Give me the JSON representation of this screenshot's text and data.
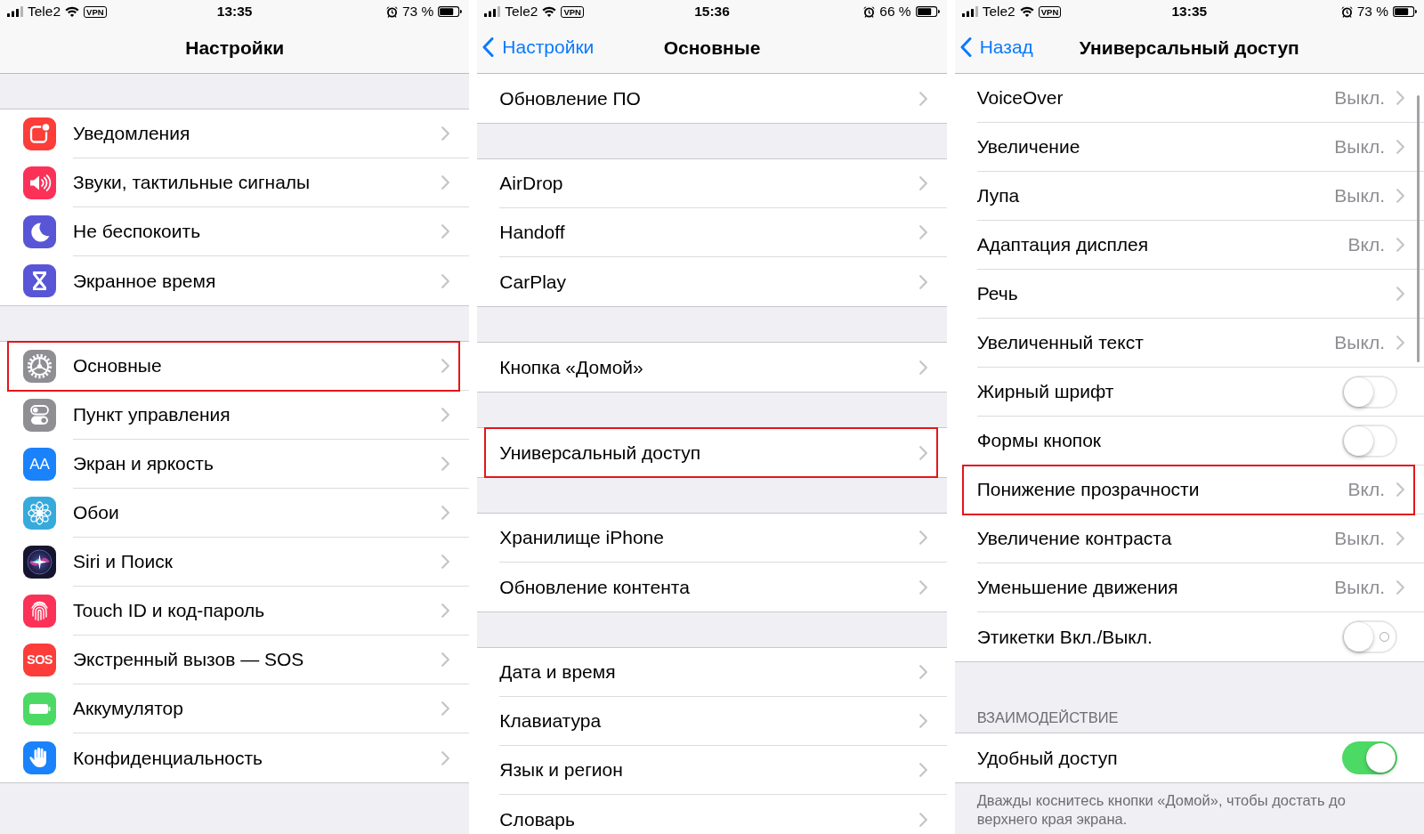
{
  "screens": [
    {
      "status_bar": {
        "carrier": "Tele2",
        "vpn": "VPN",
        "time": "13:35",
        "battery": "73 %"
      },
      "nav_bar": {
        "title": "Настройки"
      },
      "scrolled": false,
      "scroll_indicator": false,
      "sections": [
        {
          "rows": [
            {
              "kind": "link",
              "label": "Уведомления",
              "highlighted": false
            },
            {
              "kind": "link",
              "label": "Звуки, тактильные сигналы",
              "highlighted": false
            },
            {
              "kind": "link",
              "label": "Не беспокоить",
              "highlighted": false
            },
            {
              "kind": "link",
              "label": "Экранное время",
              "highlighted": false
            }
          ]
        },
        {
          "rows": [
            {
              "kind": "link",
              "label": "Основные",
              "highlighted": true
            },
            {
              "kind": "link",
              "label": "Пункт управления",
              "highlighted": false
            },
            {
              "kind": "link",
              "icon_text": "AA",
              "label": "Экран и яркость",
              "highlighted": false
            },
            {
              "kind": "link",
              "label": "Обои",
              "highlighted": false
            },
            {
              "kind": "link",
              "label": "Siri и Поиск",
              "highlighted": false
            },
            {
              "kind": "link",
              "label": "Touch ID и код-пароль",
              "highlighted": false
            },
            {
              "kind": "link",
              "icon_text": "SOS",
              "label": "Экстренный вызов — SOS",
              "highlighted": false
            },
            {
              "kind": "link",
              "label": "Аккумулятор",
              "highlighted": false
            },
            {
              "kind": "link",
              "label": "Конфиденциальность",
              "highlighted": false
            }
          ]
        }
      ]
    },
    {
      "status_bar": {
        "carrier": "Tele2",
        "vpn": "VPN",
        "time": "15:36",
        "battery": "66 %"
      },
      "nav_bar": {
        "back": "Настройки",
        "title": "Основные"
      },
      "scrolled": true,
      "scroll_indicator": false,
      "sections": [
        {
          "rows": [
            {
              "kind": "link",
              "label": "Обновление ПО",
              "highlighted": false
            }
          ]
        },
        {
          "rows": [
            {
              "kind": "link",
              "label": "AirDrop",
              "highlighted": false
            },
            {
              "kind": "link",
              "label": "Handoff",
              "highlighted": false
            },
            {
              "kind": "link",
              "label": "CarPlay",
              "highlighted": false
            }
          ]
        },
        {
          "rows": [
            {
              "kind": "link",
              "label": "Кнопка «Домой»",
              "highlighted": false
            }
          ]
        },
        {
          "rows": [
            {
              "kind": "link",
              "label": "Универсальный доступ",
              "highlighted": true
            }
          ]
        },
        {
          "rows": [
            {
              "kind": "link",
              "label": "Хранилище iPhone",
              "highlighted": false
            },
            {
              "kind": "link",
              "label": "Обновление контента",
              "highlighted": false
            }
          ]
        },
        {
          "rows": [
            {
              "kind": "link",
              "label": "Дата и время",
              "highlighted": false
            },
            {
              "kind": "link",
              "label": "Клавиатура",
              "highlighted": false
            },
            {
              "kind": "link",
              "label": "Язык и регион",
              "highlighted": false
            },
            {
              "kind": "link",
              "label": "Словарь",
              "highlighted": false
            }
          ]
        }
      ]
    },
    {
      "status_bar": {
        "carrier": "Tele2",
        "vpn": "VPN",
        "time": "13:35",
        "battery": "73 %"
      },
      "nav_bar": {
        "back": "Назад",
        "title": "Универсальный доступ"
      },
      "scrolled": true,
      "scroll_indicator": true,
      "sections": [
        {
          "rows": [
            {
              "kind": "link",
              "label": "VoiceOver",
              "value": "Выкл.",
              "highlighted": false
            },
            {
              "kind": "link",
              "label": "Увеличение",
              "value": "Выкл.",
              "highlighted": false
            },
            {
              "kind": "link",
              "label": "Лупа",
              "value": "Выкл.",
              "highlighted": false
            },
            {
              "kind": "link",
              "label": "Адаптация дисплея",
              "value": "Вкл.",
              "highlighted": false
            },
            {
              "kind": "link",
              "label": "Речь",
              "highlighted": false
            },
            {
              "kind": "link",
              "label": "Увеличенный текст",
              "value": "Выкл.",
              "highlighted": false
            },
            {
              "kind": "toggle",
              "label": "Жирный шрифт",
              "on": false,
              "off_label": false,
              "highlighted": false
            },
            {
              "kind": "toggle",
              "label": "Формы кнопок",
              "on": false,
              "off_label": false,
              "highlighted": false
            },
            {
              "kind": "link",
              "label": "Понижение прозрачности",
              "value": "Вкл.",
              "highlighted": true
            },
            {
              "kind": "link",
              "label": "Увеличение контраста",
              "value": "Выкл.",
              "highlighted": false
            },
            {
              "kind": "link",
              "label": "Уменьшение движения",
              "value": "Выкл.",
              "highlighted": false
            },
            {
              "kind": "toggle",
              "label": "Этикетки Вкл./Выкл.",
              "on": false,
              "off_label": true,
              "highlighted": false
            }
          ]
        },
        {
          "header": "ВЗАИМОДЕЙСТВИЕ",
          "rows": [
            {
              "kind": "toggle",
              "label": "Удобный доступ",
              "on": true,
              "off_label": false,
              "highlighted": false
            }
          ],
          "footer": "Дважды коснитесь кнопки «Домой», чтобы достать до верхнего края экрана."
        }
      ]
    }
  ]
}
